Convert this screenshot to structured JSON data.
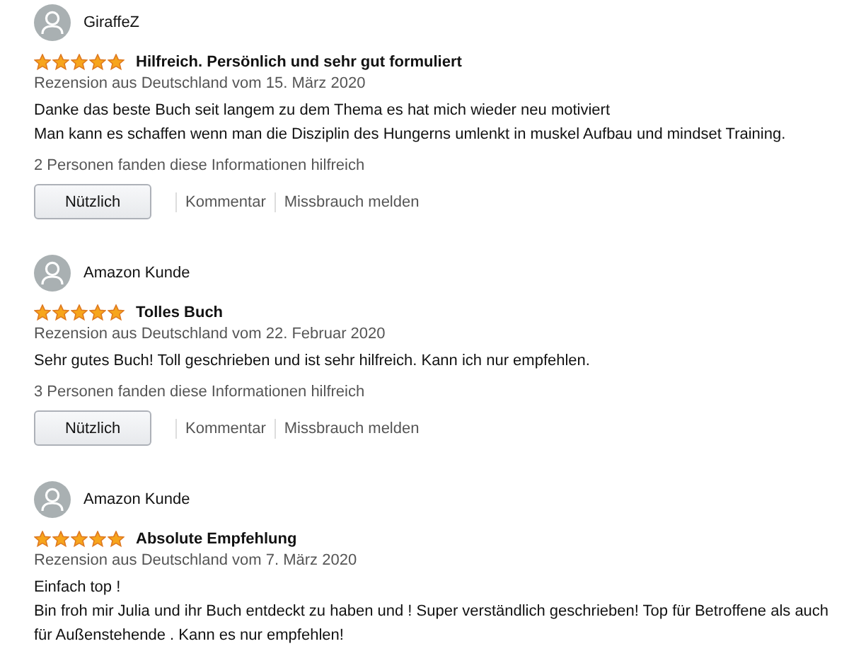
{
  "reviews": [
    {
      "author": "GiraffeZ",
      "stars": 5,
      "title": "Hilfreich. Persönlich und sehr gut formuliert",
      "date": "Rezension aus Deutschland vom 15. März 2020",
      "body": [
        "Danke das beste Buch seit langem zu dem Thema es hat mich wieder neu motiviert",
        "Man kann es schaffen wenn man die Disziplin des Hungerns umlenkt in muskel Aufbau und mindset Training."
      ],
      "helpful": "2 Personen fanden diese Informationen hilfreich",
      "actions": {
        "useful": "Nützlich",
        "comment": "Kommentar",
        "report": "Missbrauch melden"
      }
    },
    {
      "author": "Amazon Kunde",
      "stars": 5,
      "title": "Tolles Buch",
      "date": "Rezension aus Deutschland vom 22. Februar 2020",
      "body": [
        "Sehr gutes Buch! Toll geschrieben und ist sehr hilfreich. Kann ich nur empfehlen."
      ],
      "helpful": "3 Personen fanden diese Informationen hilfreich",
      "actions": {
        "useful": "Nützlich",
        "comment": "Kommentar",
        "report": "Missbrauch melden"
      }
    },
    {
      "author": "Amazon Kunde",
      "stars": 5,
      "title": "Absolute Empfehlung",
      "date": "Rezension aus Deutschland vom 7. März 2020",
      "body": [
        "Einfach top !",
        "Bin froh mir Julia und ihr Buch entdeckt zu haben und ! Super verständlich geschrieben! Top für Betroffene als auch für Außenstehende . Kann es nur empfehlen!"
      ]
    }
  ]
}
